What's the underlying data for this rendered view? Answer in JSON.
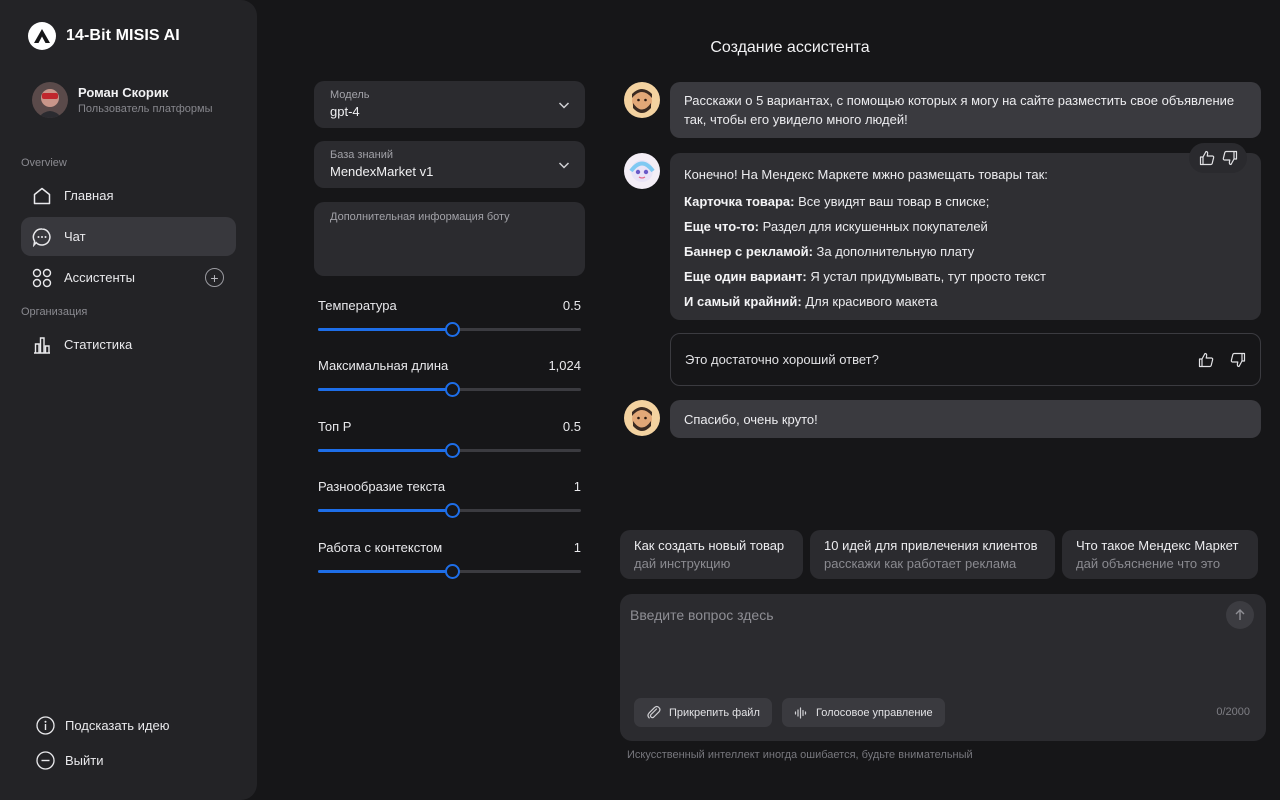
{
  "app": {
    "name": "14-Bit MISIS AI"
  },
  "user": {
    "name": "Роман Скорик",
    "role": "Пользователь платформы"
  },
  "sidebar": {
    "section_overview": "Overview",
    "section_org": "Организация",
    "items": [
      {
        "label": "Главная",
        "icon": "home-icon"
      },
      {
        "label": "Чат",
        "icon": "chat-icon",
        "active": true
      },
      {
        "label": "Ассистенты",
        "icon": "grid-icon"
      },
      {
        "label": "Статистика",
        "icon": "chart-icon"
      }
    ],
    "bottom": [
      {
        "label": "Подсказать идею",
        "icon": "info-icon"
      },
      {
        "label": "Выйти",
        "icon": "minus-circle-icon"
      }
    ]
  },
  "page": {
    "title": "Создание ассистента"
  },
  "settings": {
    "model": {
      "label": "Модель",
      "value": "gpt-4"
    },
    "knowledge": {
      "label": "База знаний",
      "value": "MendexMarket v1"
    },
    "extra_info": {
      "placeholder": "Дополнительная информация боту"
    },
    "sliders": [
      {
        "label": "Температура",
        "value": "0.5",
        "fraction": 0.51
      },
      {
        "label": "Максимальная длина",
        "value": "1,024",
        "fraction": 0.51
      },
      {
        "label": "Топ P",
        "value": "0.5",
        "fraction": 0.51
      },
      {
        "label": "Разнообразие текста",
        "value": "1",
        "fraction": 0.51
      },
      {
        "label": "Работа с контекстом",
        "value": "1",
        "fraction": 0.51
      }
    ]
  },
  "chat": {
    "msg1": "Расскажи о 5 вариантах, с помощью которых я могу на сайте разместить свое объявление так, чтобы его увидело много людей!",
    "bot": {
      "intro": "Конечно! На Мендекс Маркете мжно размещать товары так:",
      "lines": [
        {
          "bold": "Карточка товара:",
          "text": " Все увидят ваш товар в списке;"
        },
        {
          "bold": "Еще что-то:",
          "text": " Раздел для искушенных покупателей"
        },
        {
          "bold": "Баннер с рекламой:",
          "text": " За дополнительную плату"
        },
        {
          "bold": "Еще один вариант:",
          "text": " Я устал придумывать, тут просто текст"
        },
        {
          "bold": "И самый крайний:",
          "text": " Для красивого макета"
        }
      ]
    },
    "rate_question": "Это достаточно хороший ответ?",
    "msg2": "Спасибо, очень круто!"
  },
  "suggestions": [
    {
      "title": "Как создать новый товар",
      "sub": "дай инструкцию"
    },
    {
      "title": "10 идей для привлечения клиентов",
      "sub": "расскажи как работает реклама"
    },
    {
      "title": "Что такое Мендекс Маркет",
      "sub": "дай объяснение что это"
    }
  ],
  "composer": {
    "placeholder": "Введите вопрос здесь",
    "attach_label": "Прикрепить файл",
    "voice_label": "Голосовое управление",
    "counter": "0/2000"
  },
  "disclaimer": "Искусственный интеллект иногда ошибается, будьте внимательный",
  "colors": {
    "accent": "#1e6ee8",
    "background": "#161618",
    "panel": "#232326"
  }
}
